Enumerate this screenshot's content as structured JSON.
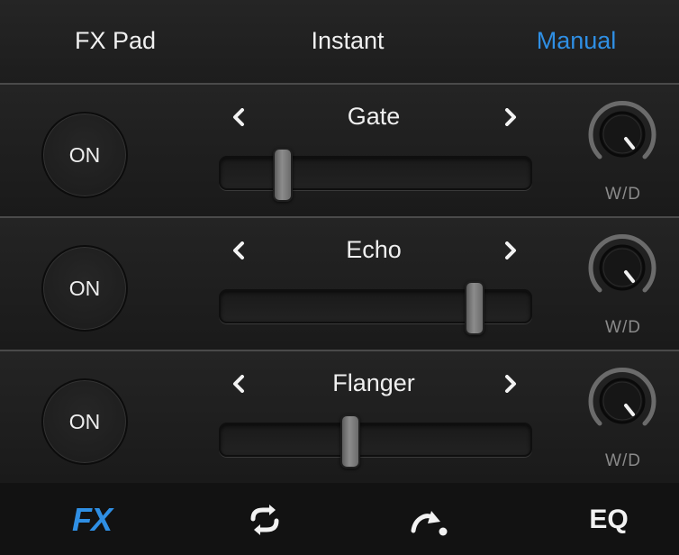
{
  "top_tabs": [
    {
      "label": "FX Pad",
      "active": false
    },
    {
      "label": "Instant",
      "active": false
    },
    {
      "label": "Manual",
      "active": true
    }
  ],
  "effects": [
    {
      "on_label": "ON",
      "name": "Gate",
      "prev_icon": "chevron-left-icon",
      "next_icon": "chevron-right-icon",
      "slider_value": 0.2,
      "knob_label": "W/D"
    },
    {
      "on_label": "ON",
      "name": "Echo",
      "prev_icon": "chevron-left-icon",
      "next_icon": "chevron-right-icon",
      "slider_value": 0.82,
      "knob_label": "W/D"
    },
    {
      "on_label": "ON",
      "name": "Flanger",
      "prev_icon": "chevron-left-icon",
      "next_icon": "chevron-right-icon",
      "slider_value": 0.42,
      "knob_label": "W/D"
    }
  ],
  "bottom_nav": {
    "fx_label": "FX",
    "loop_icon": "loop-icon",
    "cue_icon": "cue-jump-icon",
    "eq_label": "EQ"
  },
  "colors": {
    "accent": "#2f8fe4",
    "text": "#ececec",
    "label_dim": "#8a8a8a"
  }
}
